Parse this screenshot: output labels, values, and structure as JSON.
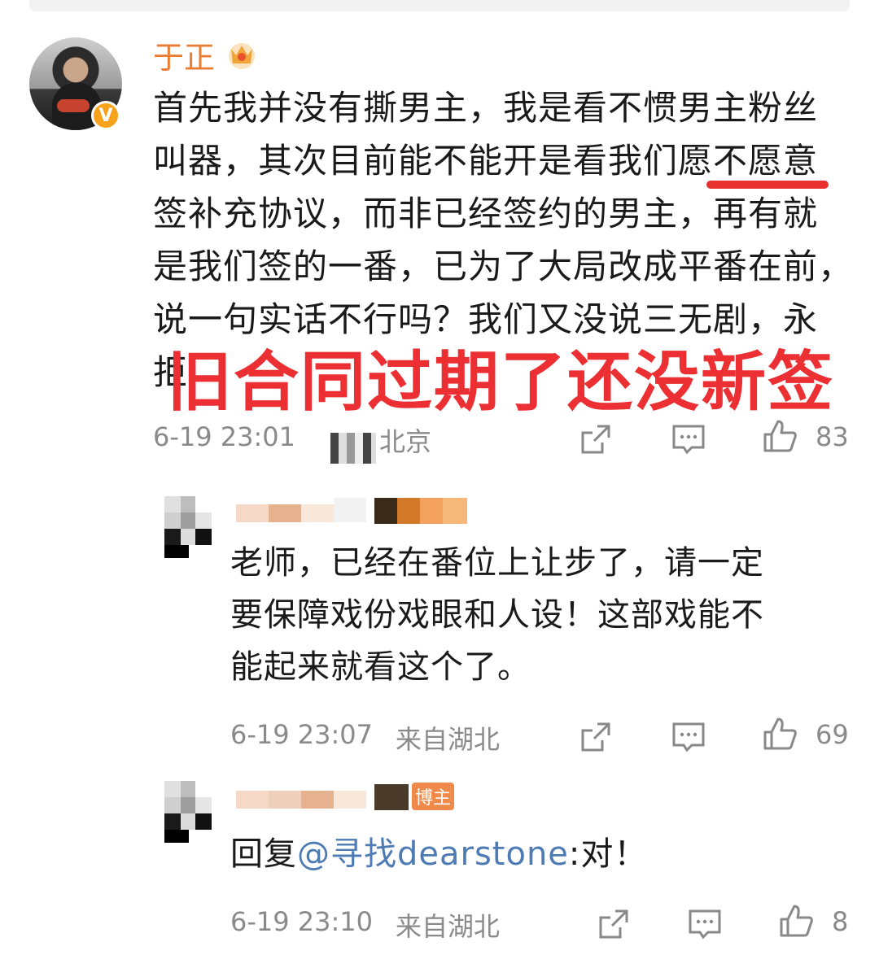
{
  "post": {
    "username": "于正",
    "verified_mark": "V",
    "text_lines": [
      "首先我并没有撕男主，我是看不惯男主粉丝",
      "叫器，其次目前能不能开是看我们愿不愿意",
      "签补充协议，而非已经签约的男主，再有就",
      "是我们签的一番，已为了大局改成平番在前，",
      "说一句实话不行吗？我们又没说三无剧，永",
      "拒"
    ],
    "overlay_caption": "旧合同过期了还没新签",
    "time": "6-19 23:01",
    "location": "北京",
    "likes": "83"
  },
  "replies": [
    {
      "text_lines": [
        "老师，已经在番位上让步了，请一定",
        "要保障戏份戏眼和人设！这部戏能不",
        "能起来就看这个了。"
      ],
      "time": "6-19 23:07",
      "location": "来自湖北",
      "likes": "69"
    },
    {
      "badge": "博主",
      "reply_prefix": "回复",
      "mention": "@寻找dearstone",
      "reply_suffix": ":对！",
      "time": "6-19 23:10",
      "location": "来自湖北",
      "likes": "8"
    }
  ],
  "icons": [
    "share-icon",
    "comment-icon",
    "like-icon",
    "crown-icon"
  ],
  "colors": {
    "username": "#ea7d33",
    "overlay": "#ec2f33",
    "mention": "#4f7bb5",
    "meta": "#8a8a8a",
    "badge": "#ef8a4b"
  }
}
